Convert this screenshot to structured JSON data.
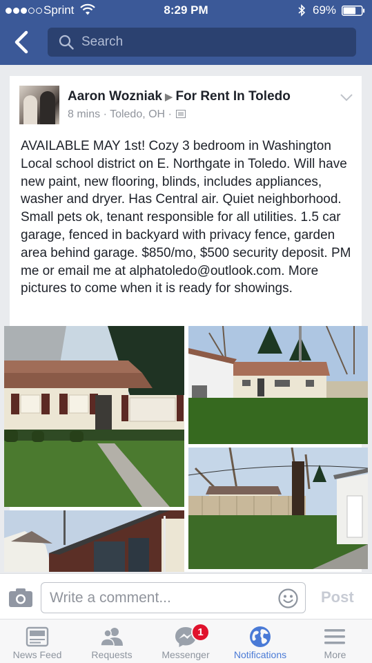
{
  "status_bar": {
    "carrier": "Sprint",
    "time": "8:29 PM",
    "battery": "69%",
    "battery_level": 0.69,
    "signal_bars_filled": 3,
    "signal_bars_total": 5
  },
  "nav": {
    "back_icon": "back-chevron-icon",
    "search_placeholder": "Search"
  },
  "post": {
    "author": "Aaron Wozniak",
    "group": "For Rent In Toledo",
    "time": "8 mins",
    "location": "Toledo, OH",
    "separator": "·",
    "body": "AVAILABLE MAY 1st!  Cozy 3 bedroom in Washington Local school district on E. Northgate in Toledo. Will have new paint, new flooring, blinds, includes appliances, washer and dryer.  Has Central air.  Quiet neighborhood.  Small pets ok, tenant responsible for all utilities.  1.5 car garage, fenced in backyard with privacy fence, garden area behind garage.  $850/mo, $500 security deposit.  PM me or email me at alphatoledo@outlook.com.  More pictures to come when it is ready for showings.",
    "photos": [
      "house-front-photo",
      "backyard-photo",
      "garage-yard-photo",
      "house-side-photo"
    ]
  },
  "comment_bar": {
    "placeholder": "Write a comment...",
    "post_label": "Post"
  },
  "tabs": [
    {
      "label": "News Feed",
      "icon": "news-feed-icon",
      "active": false
    },
    {
      "label": "Requests",
      "icon": "friend-requests-icon",
      "active": false
    },
    {
      "label": "Messenger",
      "icon": "messenger-icon",
      "active": false,
      "badge": "1"
    },
    {
      "label": "Notifications",
      "icon": "globe-icon",
      "active": true
    },
    {
      "label": "More",
      "icon": "menu-icon",
      "active": false
    }
  ],
  "colors": {
    "brand_blue": "#3b5998",
    "active_tab": "#4a7ad6",
    "badge_red": "#e0122d"
  }
}
